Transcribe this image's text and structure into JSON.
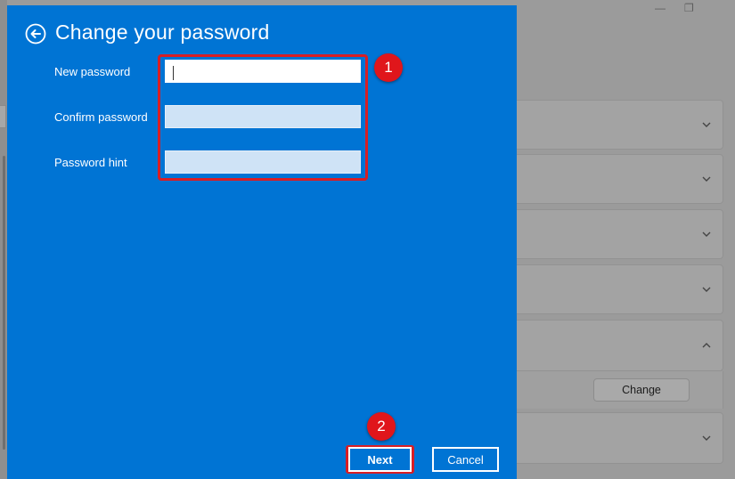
{
  "dialog": {
    "title": "Change your password",
    "fields": [
      {
        "label": "New password",
        "value": ""
      },
      {
        "label": "Confirm password",
        "value": ""
      },
      {
        "label": "Password hint",
        "value": ""
      }
    ],
    "next_label": "Next",
    "cancel_label": "Cancel"
  },
  "annotations": {
    "step1": "1",
    "step2": "2"
  },
  "background": {
    "change_label": "Change"
  },
  "colors": {
    "dialog_bg": "#0074d4",
    "highlight": "#d81e24"
  },
  "icons": {
    "back": "back-arrow-circle-icon",
    "chevron_down": "chevron-down-icon",
    "chevron_up": "chevron-up-icon"
  }
}
